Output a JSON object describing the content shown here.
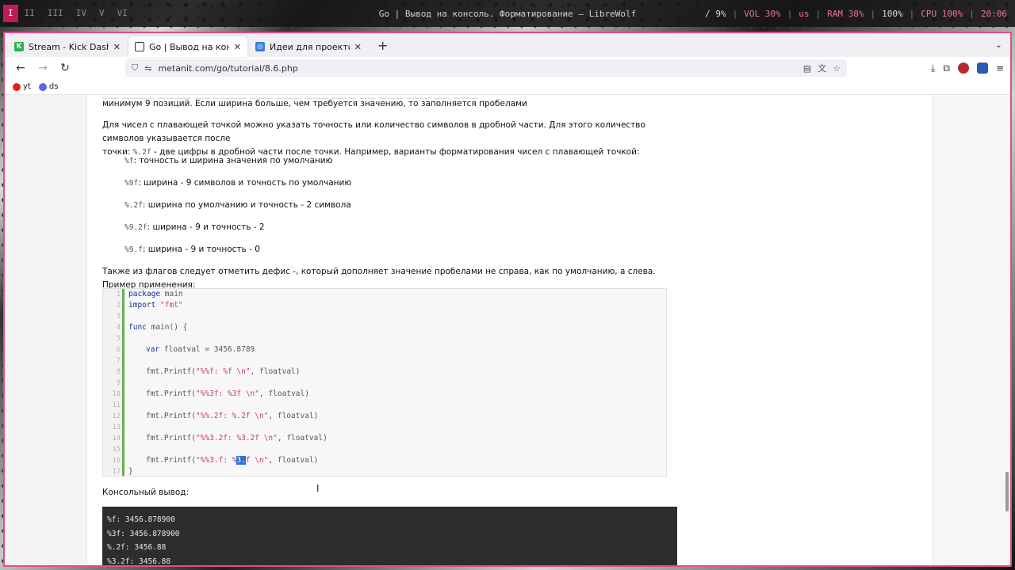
{
  "statusbar": {
    "workspaces": [
      "I",
      "II",
      "III",
      "IV",
      "V",
      "VI"
    ],
    "window_title": "Go | Вывод на консоль. Форматирование — LibreWolf",
    "stats": {
      "slash": "/ 9%",
      "vol": "VOL 30%",
      "layout": "us",
      "ram": "RAM 38%",
      "bat": "100%",
      "cpu": "CPU 100%",
      "clock": "20:06"
    }
  },
  "tabs": [
    {
      "title": "Stream - Kick Dashboar",
      "favicon_color": "#2bb24c",
      "favicon_glyph": "K"
    },
    {
      "title": "Go | Вывод на консоль",
      "favicon_color": "#333333",
      "favicon_glyph": "▢"
    },
    {
      "title": "Идеи для проектов на G",
      "favicon_color": "#3a7bd5",
      "favicon_glyph": "◎"
    }
  ],
  "nav": {
    "url": "metanit.com/go/tutorial/8.6.php"
  },
  "bookmarks": [
    {
      "label": "yt",
      "color": "#e62117"
    },
    {
      "label": "ds",
      "color": "#5865f2"
    }
  ],
  "article": {
    "p0": "минимум 9 позиций. Если ширина больше, чем требуется значению, то заполняется пробелами",
    "p1a": "Для чисел с плавающей точкой можно указать точность или количество символов в дробной части. Для этого количество символов указывается после",
    "p1b_pre": "точки: ",
    "p1b_code": "%.2f",
    "p1b_post": " - две цифры в дробной части после точки. Например, варианты форматирования чисел с плавающей точкой:",
    "specs": [
      {
        "code": "%f",
        "text": ": точность и ширина значения по умолчанию"
      },
      {
        "code": "%9f",
        "text": ": ширина - 9 символов и точность по умолчанию"
      },
      {
        "code": "%.2f",
        "text": ": ширина по умолчанию и точность - 2 символа"
      },
      {
        "code": "%9.2f",
        "text": ": ширина - 9 и точность - 2"
      },
      {
        "code": "%9.f",
        "text": ": ширина - 9 и точность - 0"
      }
    ],
    "p2": "Также из флагов следует отметить дефис -, который дополняет значение пробелами не справа, как по умолчанию, а слева. Пример применения:",
    "console_label": "Консольный вывод:"
  },
  "code": {
    "line_numbers": [
      "1",
      "2",
      "3",
      "4",
      "5",
      "6",
      "7",
      "8",
      "9",
      "10",
      "11",
      "12",
      "13",
      "14",
      "15",
      "16",
      "17"
    ],
    "l1_kw": "package",
    "l1_rest": " main",
    "l2_kw": "import",
    "l2_str": " \"fmt\"",
    "l4_kw": "func",
    "l4_rest": " main() {",
    "l6_kw": "var",
    "l6_rest": " floatval = 3456.8789",
    "l8_a": "fmt.Printf(",
    "l8_s": "\"%%f: %f \\n\"",
    "l8_b": ", floatval)",
    "l10_a": "fmt.Printf(",
    "l10_s": "\"%%3f: %3f \\n\"",
    "l10_b": ", floatval)",
    "l12_a": "fmt.Printf(",
    "l12_s": "\"%%.2f: %.2f \\n\"",
    "l12_b": ", floatval)",
    "l14_a": "fmt.Printf(",
    "l14_s": "\"%%3.2f: %3.2f \\n\"",
    "l14_b": ", floatval)",
    "l16_a": "fmt.Printf(",
    "l16_s1": "\"%%3.f: %",
    "l16_hi": "3.",
    "l16_s2": "f \\n\"",
    "l16_b": ", floatval)",
    "l17": "}"
  },
  "console": [
    "%f: 3456.878900",
    "%3f: 3456.878900",
    "%.2f: 3456.88",
    "%3.2f: 3456.88"
  ]
}
